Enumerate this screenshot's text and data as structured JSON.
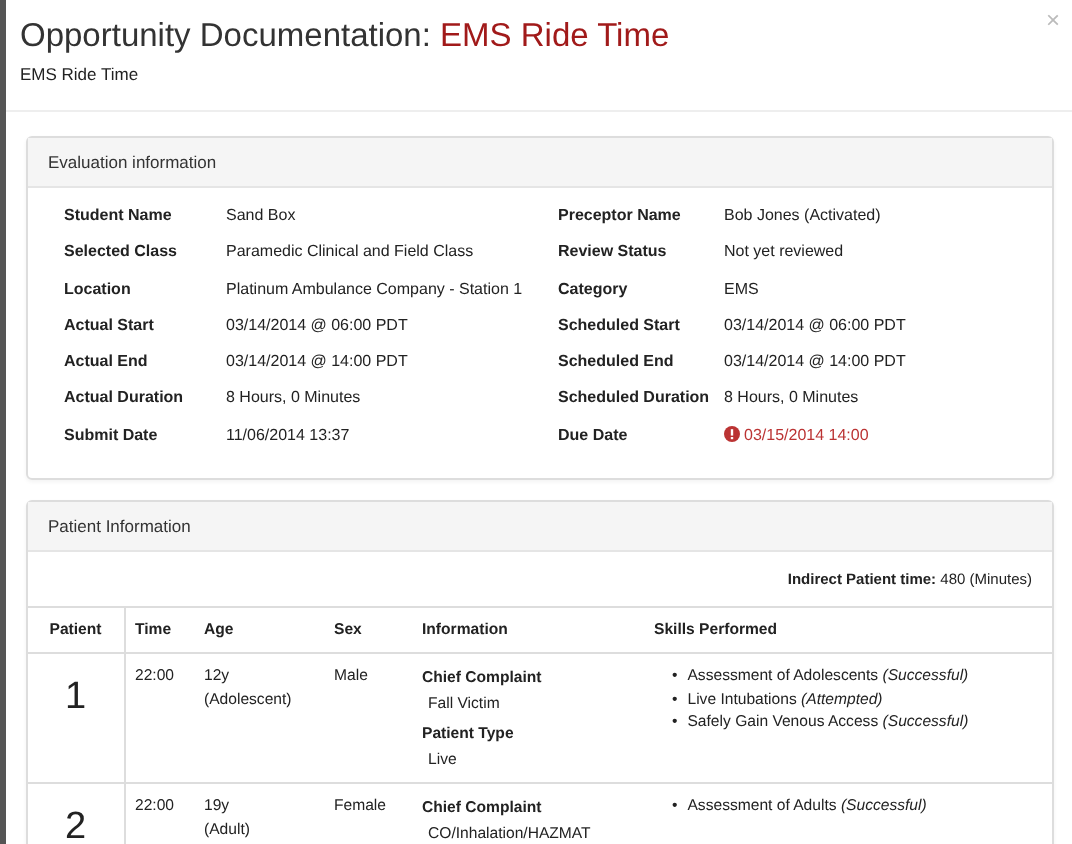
{
  "modal": {
    "title": "Opportunity Documentation: ",
    "title_highlight": "EMS Ride Time",
    "subtitle": "EMS Ride Time",
    "close": "×"
  },
  "evaluation": {
    "heading": "Evaluation information",
    "fields": [
      {
        "label": "Student Name",
        "value": "Sand Box",
        "overdue": false
      },
      {
        "label": "Preceptor Name",
        "value": "Bob Jones (Activated)",
        "overdue": false
      },
      {
        "label": "Selected Class",
        "value": "Paramedic Clinical and Field Class",
        "overdue": false
      },
      {
        "label": "Review Status",
        "value": "Not yet reviewed",
        "overdue": false
      },
      {
        "label": "Location",
        "value": "Platinum Ambulance Company - Station 1",
        "overdue": false
      },
      {
        "label": "Category",
        "value": "EMS",
        "overdue": false
      },
      {
        "label": "Actual Start",
        "value": "03/14/2014 @ 06:00 PDT",
        "overdue": false
      },
      {
        "label": "Scheduled Start",
        "value": "03/14/2014 @ 06:00 PDT",
        "overdue": false
      },
      {
        "label": "Actual End",
        "value": "03/14/2014 @ 14:00 PDT",
        "overdue": false
      },
      {
        "label": "Scheduled End",
        "value": "03/14/2014 @ 14:00 PDT",
        "overdue": false
      },
      {
        "label": "Actual Duration",
        "value": "8 Hours, 0 Minutes",
        "overdue": false
      },
      {
        "label": "Scheduled Duration",
        "value": "8 Hours, 0 Minutes",
        "overdue": false
      },
      {
        "label": "Submit Date",
        "value": "11/06/2014 13:37",
        "overdue": false
      },
      {
        "label": "Due Date",
        "value": "03/15/2014 14:00",
        "overdue": true
      }
    ]
  },
  "patients": {
    "heading": "Patient Information",
    "indirect": "**Indirect Patient time:** 480 (Minutes)",
    "columns": [
      "Patient",
      "Time",
      "Age",
      "Sex",
      "Information",
      "Skills Performed"
    ],
    "rows": [
      {
        "number": "1",
        "time": "22:00",
        "age": "12y",
        "age_group": "(Adolescent)",
        "sex": "Male",
        "info": [
          {
            "label": "Chief Complaint",
            "value": "Fall Victim"
          },
          {
            "label": "Patient Type",
            "value": "Live"
          }
        ],
        "skills": [
          {
            "marker": "•",
            "text": "Assessment of Adolescents *(Successful)*"
          },
          {
            "marker": "•",
            "text": "Live Intubations *(Attempted)*"
          },
          {
            "marker": "•",
            "text": "Safely Gain Venous Access *(Successful)*"
          }
        ]
      },
      {
        "number": "2",
        "time": "22:00",
        "age": "19y",
        "age_group": "(Adult)",
        "sex": "Female",
        "info": [
          {
            "label": "Chief Complaint",
            "value": "CO/Inhalation/HAZMAT"
          }
        ],
        "skills": [
          {
            "marker": "•",
            "text": "Assessment of Adults *(Successful)*"
          }
        ]
      }
    ]
  }
}
